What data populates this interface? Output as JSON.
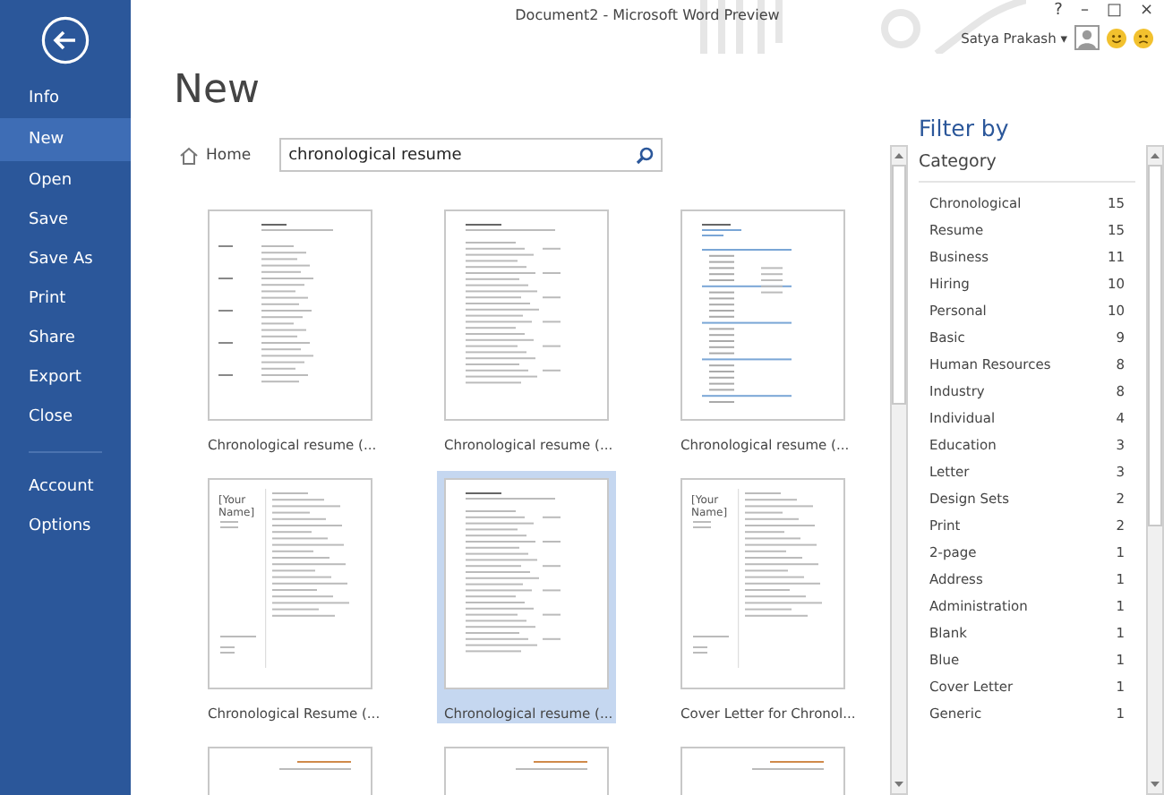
{
  "window": {
    "title": "Document2 - Microsoft Word Preview",
    "controls": [
      "?",
      "–",
      "□",
      "×"
    ]
  },
  "user": {
    "name": "Satya Prakash",
    "caret": "▾"
  },
  "sidebar": {
    "items": [
      {
        "label": "Info",
        "selected": false
      },
      {
        "label": "New",
        "selected": true
      },
      {
        "label": "Open",
        "selected": false
      },
      {
        "label": "Save",
        "selected": false
      },
      {
        "label": "Save As",
        "selected": false
      },
      {
        "label": "Print",
        "selected": false
      },
      {
        "label": "Share",
        "selected": false
      },
      {
        "label": "Export",
        "selected": false
      },
      {
        "label": "Close",
        "selected": false
      }
    ],
    "footer_items": [
      {
        "label": "Account",
        "selected": false
      },
      {
        "label": "Options",
        "selected": false
      }
    ]
  },
  "page_title": "New",
  "breadcrumb": "Home",
  "search": {
    "value": "chronological resume"
  },
  "templates": [
    {
      "title": "Chronological resume (...",
      "kind": "classic",
      "selected": false
    },
    {
      "title": "Chronological resume (...",
      "kind": "sections",
      "selected": false
    },
    {
      "title": "Chronological resume (...",
      "kind": "accent",
      "selected": false
    },
    {
      "title": "Chronological Resume (...",
      "kind": "sidebar",
      "preview_heading": "[Your Name]",
      "selected": false
    },
    {
      "title": "Chronological resume (...",
      "kind": "sections",
      "selected": true
    },
    {
      "title": "Cover Letter for Chronol...",
      "kind": "letter",
      "preview_heading": "[Your Name]",
      "selected": false
    },
    {
      "kind": "header",
      "selected": false
    },
    {
      "kind": "header",
      "selected": false
    },
    {
      "kind": "header",
      "selected": false
    }
  ],
  "filter": {
    "title": "Filter by",
    "heading": "Category",
    "categories": [
      {
        "name": "Chronological",
        "count": "15"
      },
      {
        "name": "Resume",
        "count": "15"
      },
      {
        "name": "Business",
        "count": "11"
      },
      {
        "name": "Hiring",
        "count": "10"
      },
      {
        "name": "Personal",
        "count": "10"
      },
      {
        "name": "Basic",
        "count": "9"
      },
      {
        "name": "Human Resources",
        "count": "8"
      },
      {
        "name": "Industry",
        "count": "8"
      },
      {
        "name": "Individual",
        "count": "4"
      },
      {
        "name": "Education",
        "count": "3"
      },
      {
        "name": "Letter",
        "count": "3"
      },
      {
        "name": "Design Sets",
        "count": "2"
      },
      {
        "name": "Print",
        "count": "2"
      },
      {
        "name": "2-page",
        "count": "1"
      },
      {
        "name": "Address",
        "count": "1"
      },
      {
        "name": "Administration",
        "count": "1"
      },
      {
        "name": "Blank",
        "count": "1"
      },
      {
        "name": "Blue",
        "count": "1"
      },
      {
        "name": "Cover Letter",
        "count": "1"
      },
      {
        "name": "Generic",
        "count": "1"
      }
    ]
  }
}
